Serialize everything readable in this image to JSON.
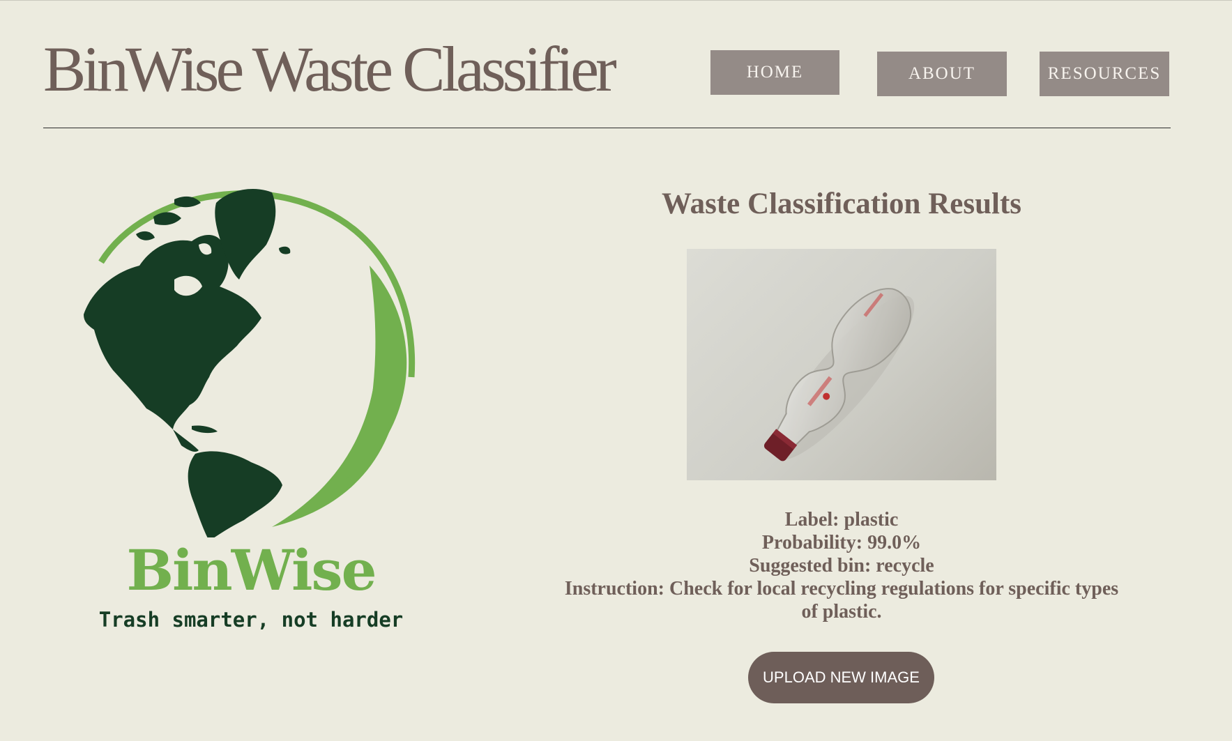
{
  "header": {
    "title": "BinWise Waste Classifier",
    "nav": {
      "home": "HOME",
      "about": "ABOUT",
      "resources": "RESOURCES"
    }
  },
  "logo": {
    "brand_name": "BinWise",
    "tagline": "Trash smarter, not harder",
    "icon": "globe-leaf-icon"
  },
  "results": {
    "title": "Waste Classification Results",
    "image": "plastic-bottle-photo",
    "label": "Label: plastic",
    "probability": "Probability: 99.0%",
    "suggested_bin": "Suggested bin: recycle",
    "instruction": "Instruction: Check for local recycling regulations for specific types of plastic.",
    "upload_button": "UPLOAD NEW IMAGE"
  },
  "colors": {
    "background": "#ecebdf",
    "text_brown": "#6f5f59",
    "nav_button": "#948b87",
    "upload_button": "#6e5e59",
    "logo_dark_green": "#163d25",
    "logo_light_green": "#72b04e"
  }
}
